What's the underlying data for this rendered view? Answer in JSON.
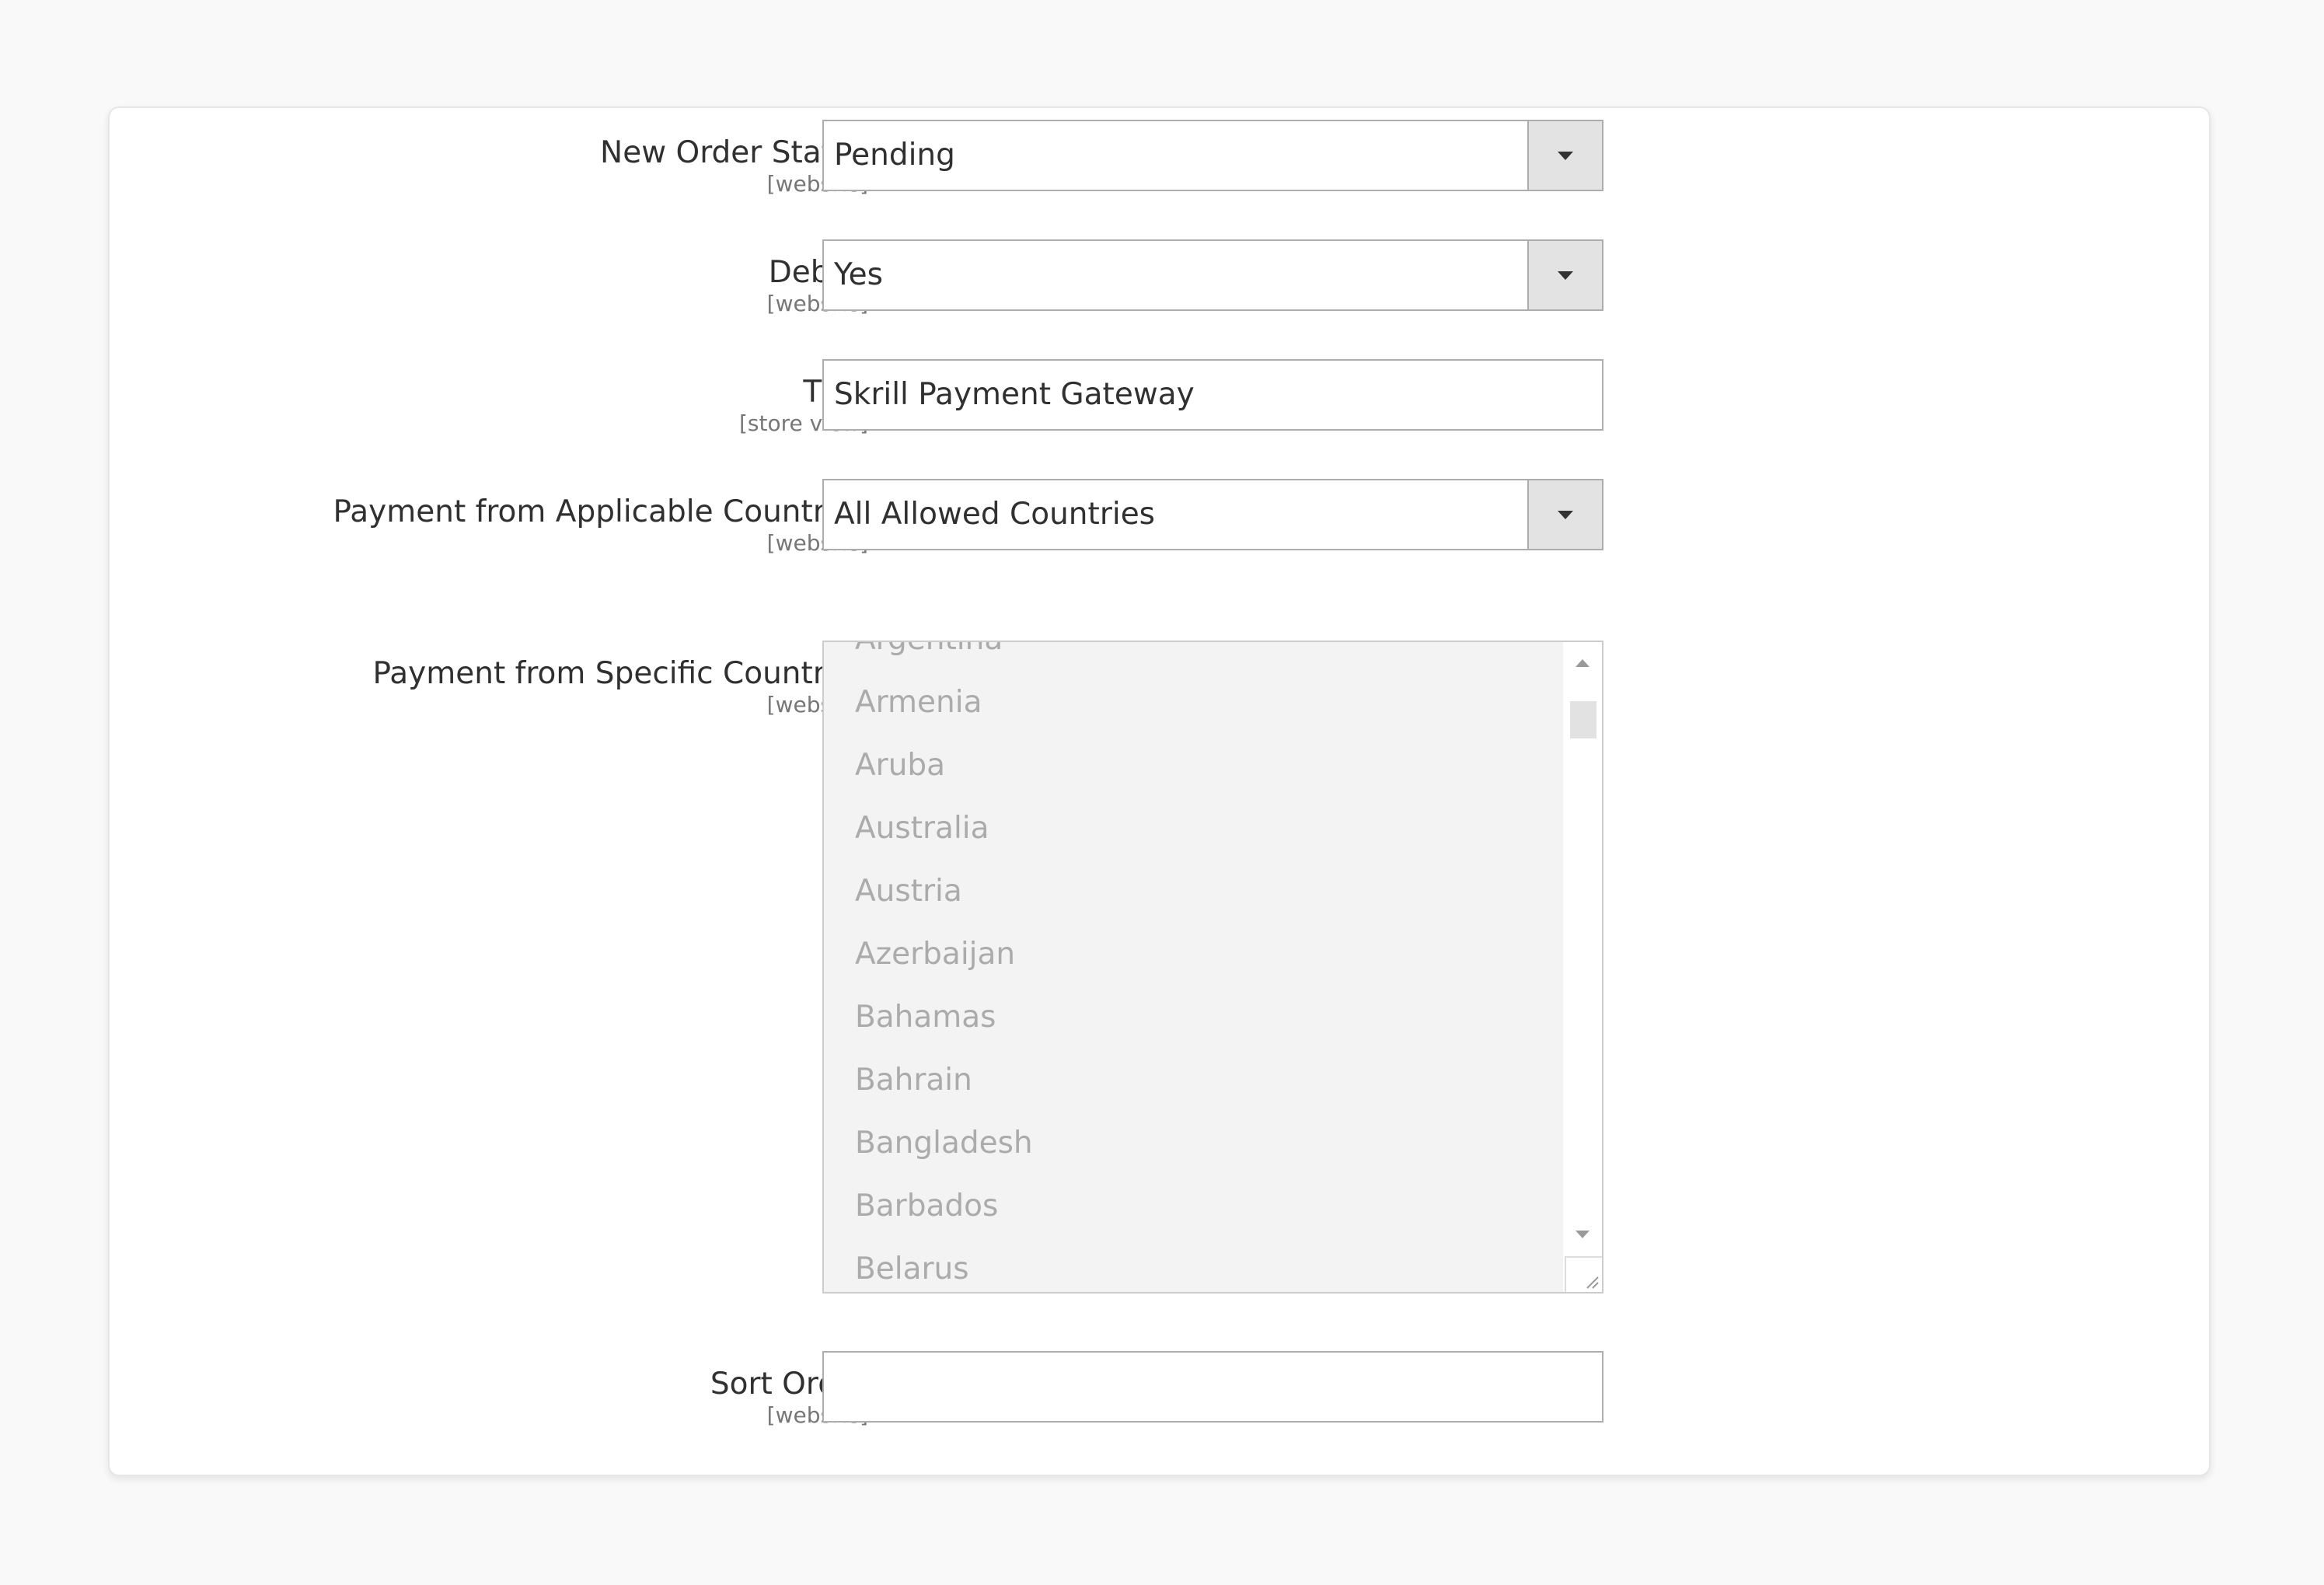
{
  "fields": {
    "new_order_status": {
      "label": "New Order Status",
      "scope": "[website]",
      "value": "Pending"
    },
    "debug": {
      "label": "Debug",
      "scope": "[website]",
      "value": "Yes"
    },
    "title": {
      "label": "Title",
      "scope": "[store view]",
      "value": "Skrill Payment Gateway"
    },
    "applicable_countries": {
      "label": "Payment from Applicable Countries",
      "scope": "[website]",
      "value": "All Allowed Countries"
    },
    "specific_countries": {
      "label": "Payment from Specific Countries",
      "scope": "[website]",
      "options": [
        "Argentina",
        "Armenia",
        "Aruba",
        "Australia",
        "Austria",
        "Azerbaijan",
        "Bahamas",
        "Bahrain",
        "Bangladesh",
        "Barbados",
        "Belarus"
      ]
    },
    "sort_order": {
      "label": "Sort Order",
      "scope": "[website]",
      "value": ""
    }
  },
  "icons": {
    "select_caret": "chevron-down-icon",
    "scroll_up": "arrow-up-icon",
    "scroll_down": "arrow-down-icon",
    "resize": "resize-grip-icon"
  },
  "colors": {
    "background": "#f9f9f9",
    "panel": "#ffffff",
    "label_text": "#303030",
    "scope_text": "#777777",
    "control_border": "#adadad",
    "select_button": "#e3e3e3",
    "disabled_list_bg": "#f3f3f3",
    "disabled_list_text": "#ababab"
  }
}
